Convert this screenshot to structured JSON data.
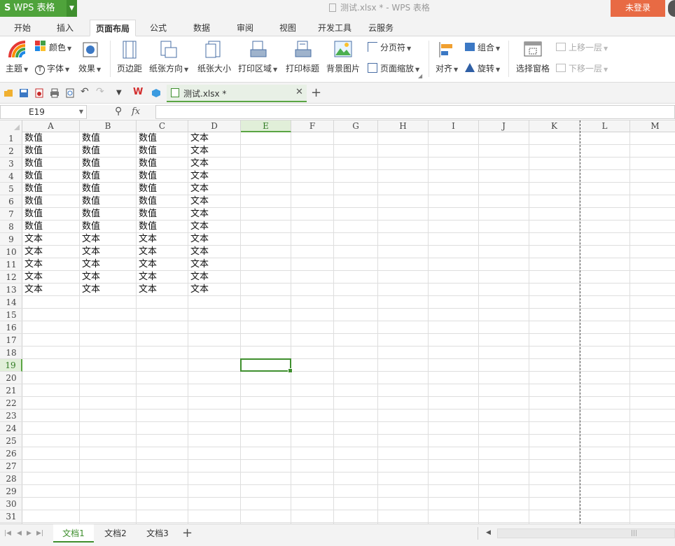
{
  "app": {
    "menu_label": "WPS 表格",
    "window_title": "测试.xlsx * - WPS 表格",
    "login": "未登录"
  },
  "tabs": [
    "开始",
    "插入",
    "页面布局",
    "公式",
    "数据",
    "审阅",
    "视图",
    "开发工具",
    "云服务"
  ],
  "active_tab": "页面布局",
  "ribbon": {
    "color_label": "颜色",
    "theme_label": "主题",
    "font_label": "字体",
    "effect_label": "效果",
    "margins_label": "页边距",
    "orientation_label": "纸张方向",
    "size_label": "纸张大小",
    "print_area_label": "打印区域",
    "print_titles_label": "打印标题",
    "background_label": "背景图片",
    "page_break_label": "分页符",
    "page_zoom_label": "页面缩放",
    "align_label": "对齐",
    "group_label": "组合",
    "rotate_label": "旋转",
    "selection_pane_label": "选择窗格",
    "bring_forward_label": "上移一层",
    "send_backward_label": "下移一层"
  },
  "doc_tab": {
    "name": "测试.xlsx *"
  },
  "formula_bar": {
    "name_box": "E19",
    "fx": "fx",
    "formula": ""
  },
  "columns": [
    "A",
    "B",
    "C",
    "D",
    "E",
    "F",
    "G",
    "H",
    "I",
    "J",
    "K",
    "L",
    "M"
  ],
  "rows": [
    "1",
    "2",
    "3",
    "4",
    "5",
    "6",
    "7",
    "8",
    "9",
    "10",
    "11",
    "12",
    "13",
    "14",
    "15",
    "16",
    "17",
    "18",
    "19",
    "20",
    "21",
    "22",
    "23",
    "24",
    "25",
    "26",
    "27",
    "28",
    "29",
    "30",
    "31"
  ],
  "cell_data": [
    [
      "数值",
      "数值",
      "数值",
      "文本"
    ],
    [
      "数值",
      "数值",
      "数值",
      "文本"
    ],
    [
      "数值",
      "数值",
      "数值",
      "文本"
    ],
    [
      "数值",
      "数值",
      "数值",
      "文本"
    ],
    [
      "数值",
      "数值",
      "数值",
      "文本"
    ],
    [
      "数值",
      "数值",
      "数值",
      "文本"
    ],
    [
      "数值",
      "数值",
      "数值",
      "文本"
    ],
    [
      "数值",
      "数值",
      "数值",
      "文本"
    ],
    [
      "文本",
      "文本",
      "文本",
      "文本"
    ],
    [
      "文本",
      "文本",
      "文本",
      "文本"
    ],
    [
      "文本",
      "文本",
      "文本",
      "文本"
    ],
    [
      "文本",
      "文本",
      "文本",
      "文本"
    ],
    [
      "文本",
      "文本",
      "文本",
      "文本"
    ]
  ],
  "selected_cell": "E19",
  "sheets": [
    "文档1",
    "文档2",
    "文档3"
  ],
  "active_sheet": "文档1",
  "colors": {
    "accent": "#4fa33b",
    "login": "#e86a44",
    "selection": "#3f8f2e"
  }
}
